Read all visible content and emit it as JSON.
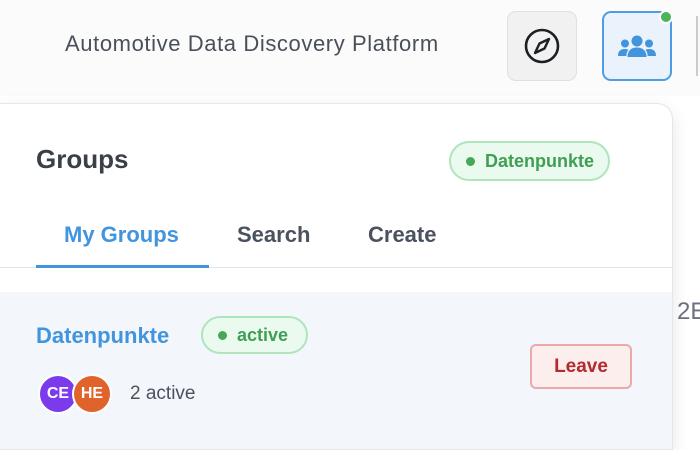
{
  "header": {
    "title": "Automotive Data Discovery Platform",
    "discover_icon": "compass-icon",
    "groups_icon": "users-group-icon",
    "groups_status_color": "#4bb35a"
  },
  "background": {
    "peek_text": "2E"
  },
  "groups_panel": {
    "title": "Groups",
    "current_group_badge": "Datenpunkte",
    "tabs": [
      {
        "label": "My Groups",
        "active": true
      },
      {
        "label": "Search",
        "active": false
      },
      {
        "label": "Create",
        "active": false
      }
    ],
    "groups": [
      {
        "name": "Datenpunkte",
        "status": "active",
        "members": [
          {
            "initials": "CE",
            "color": "#7c3aed"
          },
          {
            "initials": "HE",
            "color": "#e0632b"
          }
        ],
        "active_count": "2 active",
        "leave_label": "Leave"
      }
    ]
  },
  "colors": {
    "accent": "#4295dd",
    "success": "#46a758",
    "danger": "#b3292e"
  }
}
